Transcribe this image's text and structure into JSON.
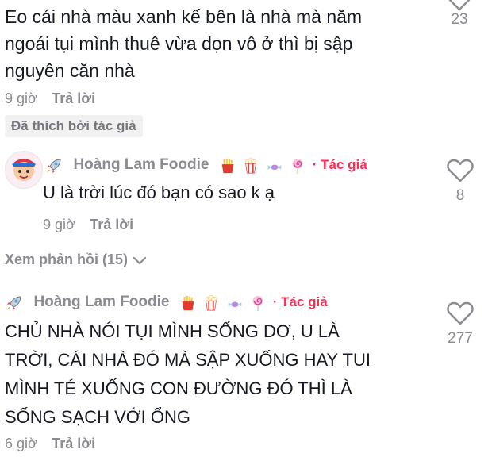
{
  "comments": [
    {
      "text_lines": [
        "Eo cái nhà màu xanh kế bên là nhà mà năm",
        "ngoái tụi mình thuê vừa dọn vô ở thì bị sập",
        "nguyên căn nhà"
      ],
      "time": "9 giờ",
      "reply": "Trả lời",
      "liked_by_author": "Đã thích bởi tác giả",
      "likes": "23"
    },
    {
      "author": "Hoàng Lam Foodie",
      "tag": "· Tác giả",
      "text": "U là trời lúc đó bạn có sao k ạ",
      "time": "9 giờ",
      "reply": "Trả lời",
      "likes": "8"
    },
    {
      "author": "Hoàng Lam Foodie",
      "tag": "· Tác giả",
      "text_lines": [
        "CHỦ NHÀ NÓI TỤI MÌNH SỐNG DƠ, U LÀ",
        "TRỜI, CÁI NHÀ ĐÓ MÀ SẬP XUỐNG HAY TUI",
        "MÌNH TÉ XUỐNG CON ĐƯỜNG ĐÓ THÌ LÀ",
        "SỐNG SẠCH VỚI ỔNG"
      ],
      "time": "6 giờ",
      "reply": "Trả lời",
      "likes": "277"
    }
  ],
  "view_replies": "Xem phản hồi (15)",
  "icons": {
    "heart": "heart-outline-icon",
    "rocket": "rocket-icon",
    "fries": "fries-icon",
    "popcorn": "popcorn-icon",
    "candy": "candy-icon",
    "lollipop": "lollipop-icon",
    "chevron": "chevron-down-icon"
  },
  "colors": {
    "text": "#161823",
    "muted": "#8a8b91",
    "author_tag": "#fe2c55",
    "badge_bg": "#f1f1f2"
  }
}
